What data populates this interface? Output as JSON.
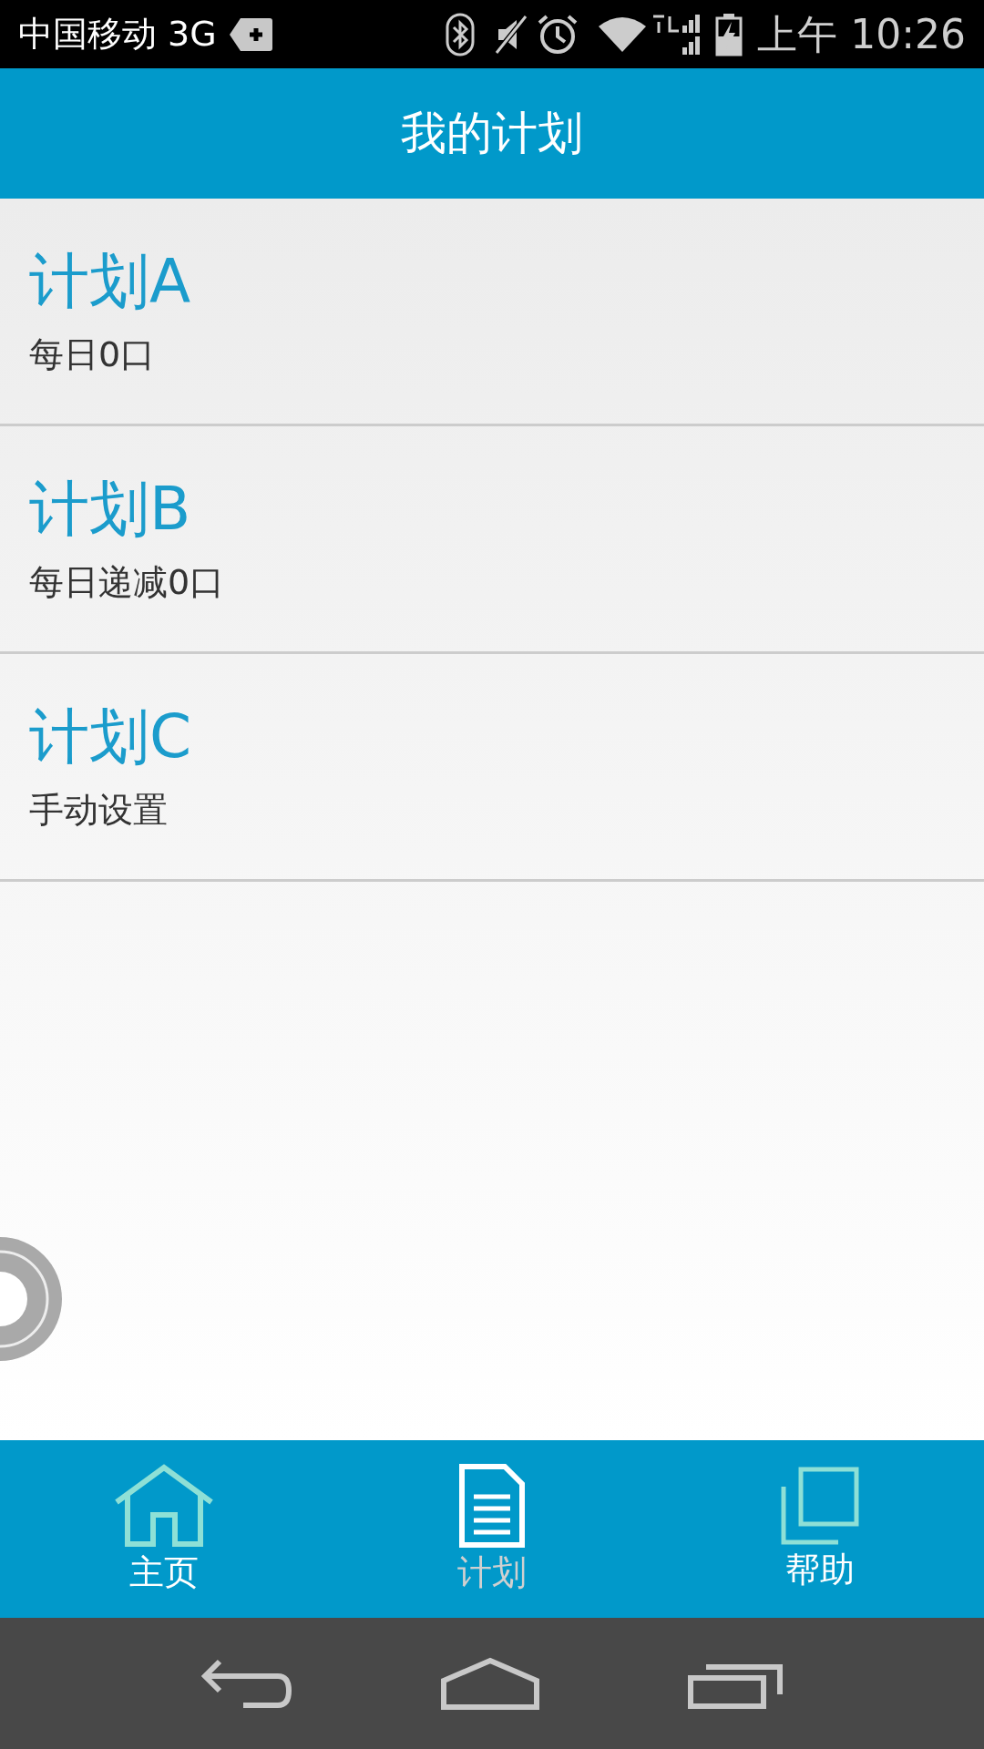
{
  "status_bar": {
    "carrier": "中国移动 3G",
    "time": "上午 10:26"
  },
  "header": {
    "title": "我的计划"
  },
  "plans": [
    {
      "title": "计划A",
      "subtitle": "每日0口"
    },
    {
      "title": "计划B",
      "subtitle": "每日递减0口"
    },
    {
      "title": "计划C",
      "subtitle": "手动设置"
    }
  ],
  "tabs": [
    {
      "label": "主页",
      "kind": "home",
      "selected": false
    },
    {
      "label": "计划",
      "kind": "plan",
      "selected": true
    },
    {
      "label": "帮助",
      "kind": "help",
      "selected": false
    }
  ]
}
